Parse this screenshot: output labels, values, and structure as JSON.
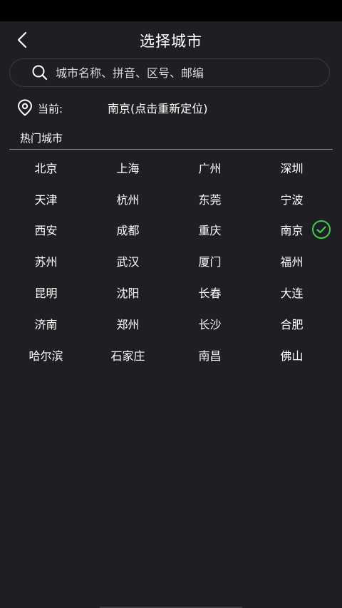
{
  "header": {
    "title": "选择城市",
    "back_icon": "chevron-left-icon"
  },
  "search": {
    "placeholder": "城市名称、拼音、区号、邮编",
    "value": "",
    "icon": "search-icon"
  },
  "current": {
    "icon": "location-pin-icon",
    "label": "当前:",
    "city_text": "南京(点击重新定位)"
  },
  "hot_cities": {
    "title": "热门城市",
    "selected_city": "南京",
    "selected_icon": "check-circle-icon",
    "check_color": "#3ecf4c",
    "items": [
      {
        "name": "北京"
      },
      {
        "name": "上海"
      },
      {
        "name": "广州"
      },
      {
        "name": "深圳"
      },
      {
        "name": "天津"
      },
      {
        "name": "杭州"
      },
      {
        "name": "东莞"
      },
      {
        "name": "宁波"
      },
      {
        "name": "西安"
      },
      {
        "name": "成都"
      },
      {
        "name": "重庆"
      },
      {
        "name": "南京"
      },
      {
        "name": "苏州"
      },
      {
        "name": "武汉"
      },
      {
        "name": "厦门"
      },
      {
        "name": "福州"
      },
      {
        "name": "昆明"
      },
      {
        "name": "沈阳"
      },
      {
        "name": "长春"
      },
      {
        "name": "大连"
      },
      {
        "name": "济南"
      },
      {
        "name": "郑州"
      },
      {
        "name": "长沙"
      },
      {
        "name": "合肥"
      },
      {
        "name": "哈尔滨"
      },
      {
        "name": "石家庄"
      },
      {
        "name": "南昌"
      },
      {
        "name": "佛山"
      }
    ]
  },
  "colors": {
    "background": "#1f1e22",
    "status_bar": "#000000",
    "text": "#ffffff",
    "divider": "#8c8c8f"
  }
}
